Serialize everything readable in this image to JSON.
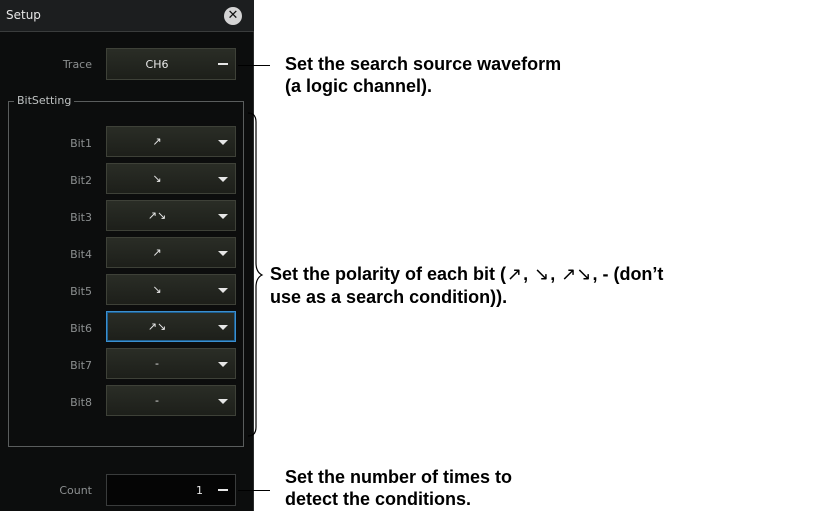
{
  "panel": {
    "title": "Setup",
    "close_glyph": "✕",
    "trace": {
      "label": "Trace",
      "value": "CH6"
    },
    "bitsetting_legend": "BitSetting",
    "bits": [
      {
        "label": "Bit1",
        "value": "↗"
      },
      {
        "label": "Bit2",
        "value": "↘"
      },
      {
        "label": "Bit3",
        "value": "↗↘"
      },
      {
        "label": "Bit4",
        "value": "↗"
      },
      {
        "label": "Bit5",
        "value": "↘"
      },
      {
        "label": "Bit6",
        "value": "↗↘"
      },
      {
        "label": "Bit7",
        "value": "-"
      },
      {
        "label": "Bit8",
        "value": "-"
      }
    ],
    "count": {
      "label": "Count",
      "value": "1"
    }
  },
  "annotations": {
    "trace_line1": "Set the search source waveform",
    "trace_line2": "(a logic channel).",
    "bits_line1_a": "Set the polarity of each bit (",
    "bits_sym1": "↗",
    "bits_sep1": ",",
    "bits_sym2": "↘",
    "bits_sep2": ",",
    "bits_sym3": "↗↘",
    "bits_line1_b": ", - (don’t",
    "bits_line2": "use as a search condition)).",
    "count_line1": "Set the number of times to",
    "count_line2": "detect the conditions."
  },
  "colors": {
    "panel_bg": "#0c0d0d",
    "field_bg": "#23261f",
    "selected_border": "#3a8fd0",
    "annotation_text": "#000000"
  }
}
